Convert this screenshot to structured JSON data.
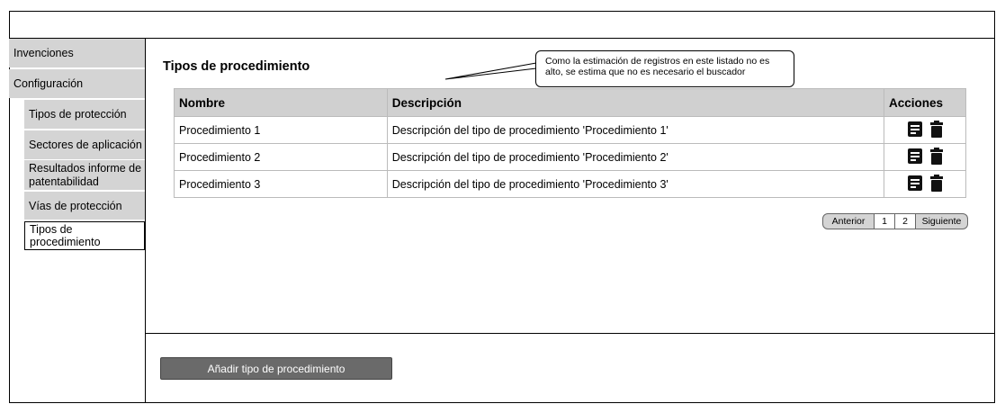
{
  "sidebar": {
    "items": [
      {
        "label": "Invenciones"
      },
      {
        "label": "Configuración"
      },
      {
        "label": "Tipos de protección"
      },
      {
        "label": "Sectores de aplicación"
      },
      {
        "label": "Resultados informe de patentabilidad"
      },
      {
        "label": "Vías de protección"
      },
      {
        "label": "Tipos de procedimiento"
      }
    ]
  },
  "main": {
    "title": "Tipos de procedimiento",
    "callout": "Como la estimación de registros en este listado no es alto, se estima que no es necesario el buscador",
    "table": {
      "headers": [
        "Nombre",
        "Descripción",
        "Acciones"
      ],
      "rows": [
        {
          "nombre": "Procedimiento 1",
          "descripcion": "Descripción del tipo de procedimiento 'Procedimiento 1'"
        },
        {
          "nombre": "Procedimiento 2",
          "descripcion": "Descripción del tipo de procedimiento 'Procedimiento 2'"
        },
        {
          "nombre": "Procedimiento 3",
          "descripcion": "Descripción del tipo de procedimiento 'Procedimiento 3'"
        }
      ],
      "row_actions": [
        "detail-icon",
        "trash-icon"
      ]
    },
    "pagination": {
      "prev": "Anterior",
      "pages": [
        "1",
        "2"
      ],
      "next": "Siguiente"
    },
    "add_button": "Añadir tipo de procedimiento"
  }
}
